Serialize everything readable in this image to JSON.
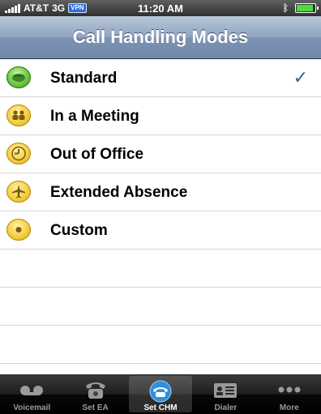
{
  "status_bar": {
    "carrier": "AT&T",
    "network": "3G",
    "vpn": "VPN",
    "time": "11:20 AM",
    "battery_color": "#4bdc3c"
  },
  "nav": {
    "title": "Call Handling Modes"
  },
  "modes": [
    {
      "label": "Standard",
      "icon": "phone-icon",
      "selected": true
    },
    {
      "label": "In a Meeting",
      "icon": "meeting-people-icon",
      "selected": false
    },
    {
      "label": "Out of Office",
      "icon": "clock-icon",
      "selected": false
    },
    {
      "label": "Extended Absence",
      "icon": "airplane-icon",
      "selected": false
    },
    {
      "label": "Custom",
      "icon": "custom-dot-icon",
      "selected": false
    }
  ],
  "checkmark": "✓",
  "tabs": [
    {
      "label": "Voicemail",
      "icon": "voicemail-icon",
      "active": false
    },
    {
      "label": "Set EA",
      "icon": "set-ea-phone-icon",
      "active": false
    },
    {
      "label": "Set CHM",
      "icon": "set-chm-phone-icon",
      "active": true
    },
    {
      "label": "Dialer",
      "icon": "dialer-card-icon",
      "active": false
    },
    {
      "label": "More",
      "icon": "more-dots-icon",
      "active": false
    }
  ],
  "colors": {
    "nav_bar": "#7d93b3",
    "check": "#3b5f93",
    "tab_bar": "#1e1e1e"
  }
}
